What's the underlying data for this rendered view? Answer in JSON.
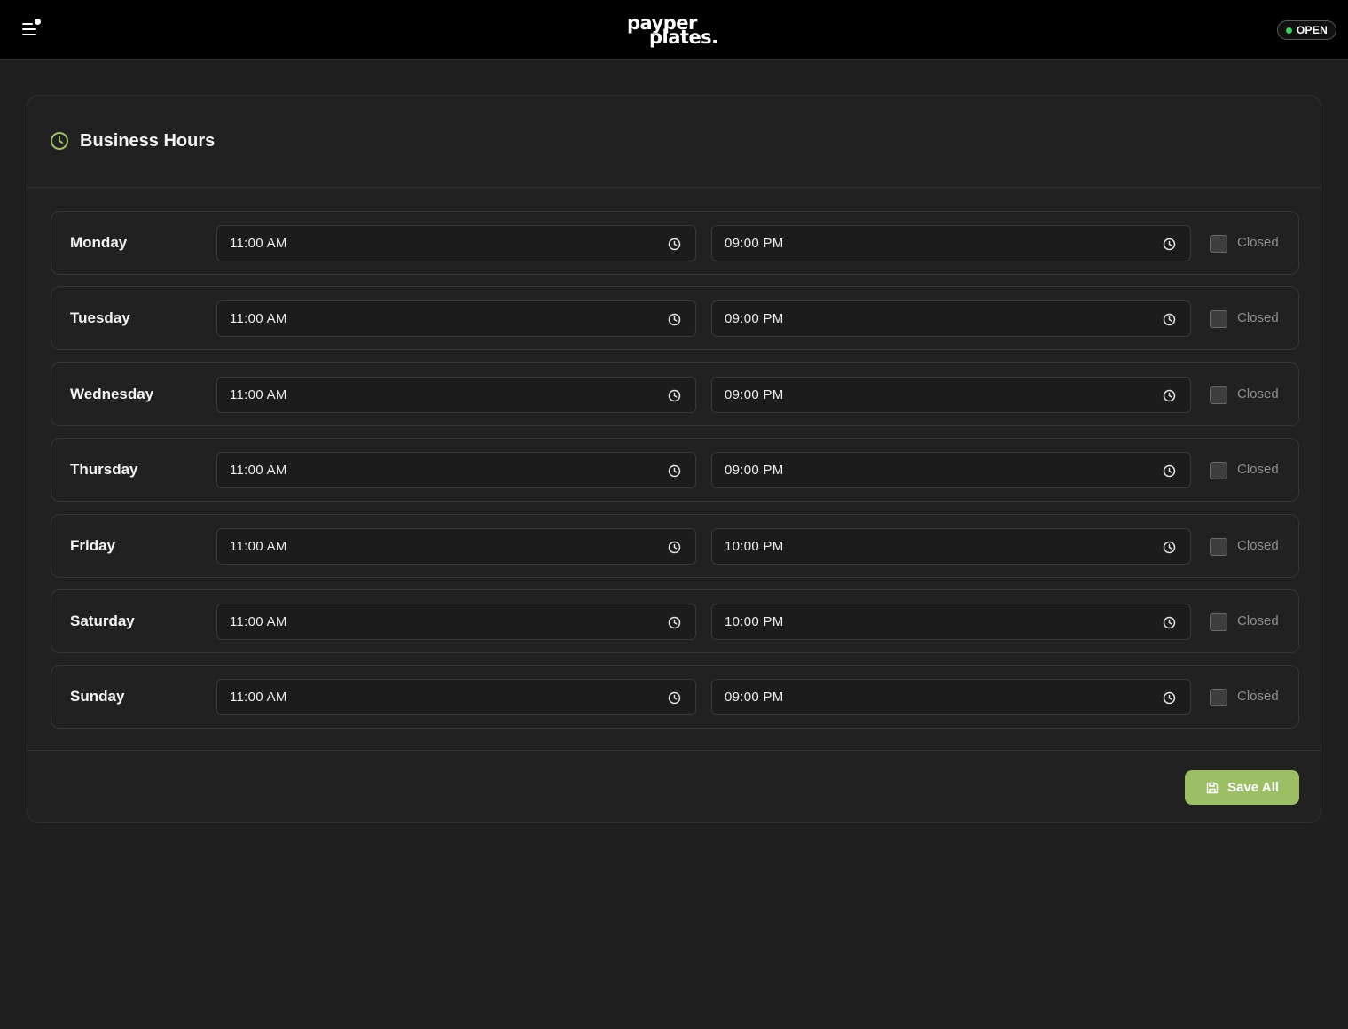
{
  "header": {
    "logo_line1": "payper",
    "logo_line2": "plates.",
    "status": "OPEN",
    "status_color": "#3ad15a"
  },
  "card": {
    "title": "Business Hours",
    "accent_color": "#9cbf66",
    "closed_label": "Closed",
    "save_label": "Save All"
  },
  "days": [
    {
      "name": "Monday",
      "open": "11:00 AM",
      "close": "09:00 PM",
      "closed": false
    },
    {
      "name": "Tuesday",
      "open": "11:00 AM",
      "close": "09:00 PM",
      "closed": false
    },
    {
      "name": "Wednesday",
      "open": "11:00 AM",
      "close": "09:00 PM",
      "closed": false
    },
    {
      "name": "Thursday",
      "open": "11:00 AM",
      "close": "09:00 PM",
      "closed": false
    },
    {
      "name": "Friday",
      "open": "11:00 AM",
      "close": "10:00 PM",
      "closed": false
    },
    {
      "name": "Saturday",
      "open": "11:00 AM",
      "close": "10:00 PM",
      "closed": false
    },
    {
      "name": "Sunday",
      "open": "11:00 AM",
      "close": "09:00 PM",
      "closed": false
    }
  ],
  "icons": {
    "menu": "menu-icon",
    "header": "clock-icon",
    "time_field": "clock-icon",
    "save": "save-icon"
  }
}
